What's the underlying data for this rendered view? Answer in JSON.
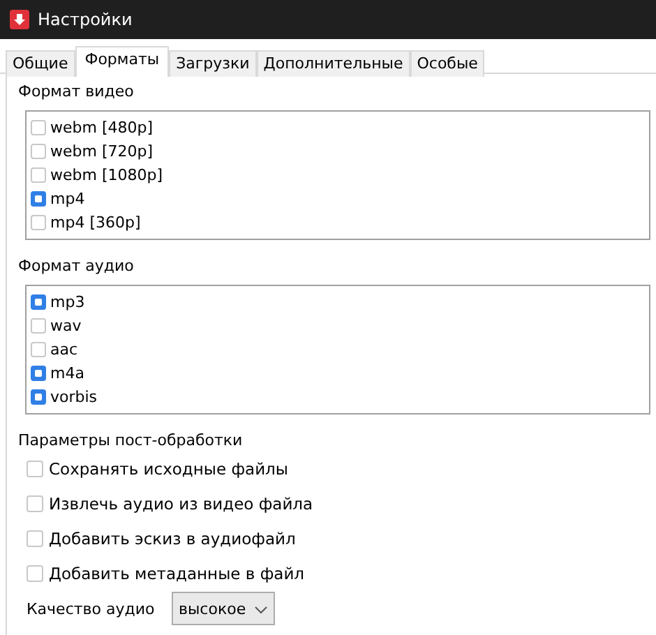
{
  "window": {
    "title": "Настройки"
  },
  "tabs": [
    {
      "label": "Общие",
      "selected": false
    },
    {
      "label": "Форматы",
      "selected": true
    },
    {
      "label": "Загрузки",
      "selected": false
    },
    {
      "label": "Дополнительные",
      "selected": false
    },
    {
      "label": "Особые",
      "selected": false
    }
  ],
  "video_format": {
    "label": "Формат видео",
    "items": [
      {
        "label": "webm [480p]",
        "checked": false
      },
      {
        "label": "webm [720p]",
        "checked": false
      },
      {
        "label": "webm [1080p]",
        "checked": false
      },
      {
        "label": "mp4",
        "checked": true
      },
      {
        "label": "mp4 [360p]",
        "checked": false
      }
    ]
  },
  "audio_format": {
    "label": "Формат аудио",
    "items": [
      {
        "label": "mp3",
        "checked": true
      },
      {
        "label": "wav",
        "checked": false
      },
      {
        "label": "aac",
        "checked": false
      },
      {
        "label": "m4a",
        "checked": true
      },
      {
        "label": "vorbis",
        "checked": true
      }
    ]
  },
  "post_processing": {
    "label": "Параметры пост-обработки",
    "options": [
      {
        "label": "Сохранять исходные файлы",
        "checked": false
      },
      {
        "label": "Извлечь аудио из видео файла",
        "checked": false
      },
      {
        "label": "Добавить эскиз в аудиофайл",
        "checked": false
      },
      {
        "label": "Добавить метаданные в файл",
        "checked": false
      }
    ]
  },
  "audio_quality": {
    "label": "Качество аудио",
    "value": "высокое"
  }
}
